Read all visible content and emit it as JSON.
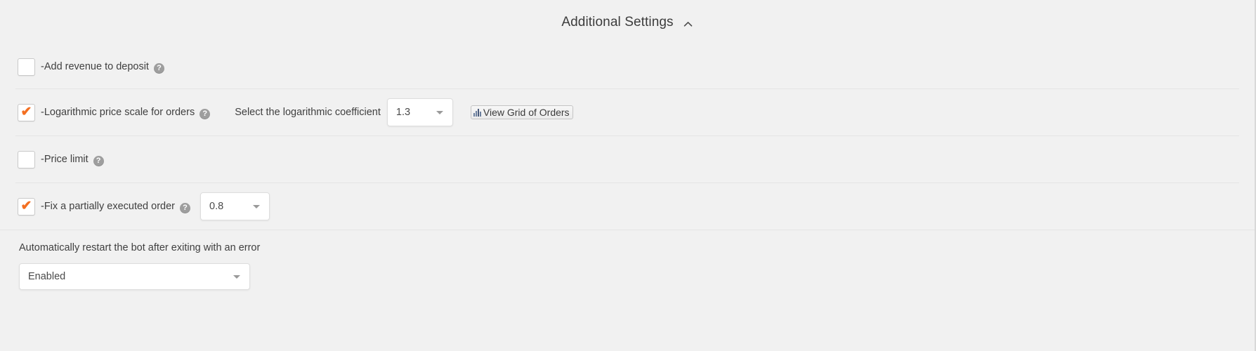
{
  "header": {
    "title": "Additional Settings",
    "collapse_icon": "chevron-up-icon"
  },
  "settings": [
    {
      "id": "add-revenue-to-deposit",
      "label": "-Add revenue to deposit",
      "checked": false,
      "help": "?"
    },
    {
      "id": "logarithmic-price-scale",
      "label": "-Logarithmic price scale for orders",
      "checked": true,
      "help": "?",
      "field_label": "Select the logarithmic coefficient",
      "field_value": "1.3",
      "button_label": "View Grid of Orders",
      "button_icon": "bar-chart-icon"
    },
    {
      "id": "price-limit",
      "label": "-Price limit",
      "checked": false,
      "help": "?"
    },
    {
      "id": "fix-partially-executed-order",
      "label": "-Fix a partially executed order",
      "checked": true,
      "help": "?",
      "field_value": "0.8"
    }
  ],
  "restart": {
    "label": "Automatically restart the bot after exiting with an error",
    "value": "Enabled"
  },
  "colors": {
    "background": "#f1f1f1",
    "accent": "#f36f21",
    "divider": "#e4e4e4",
    "text": "#3f3f3f",
    "help_icon": "#9e9e9e"
  }
}
